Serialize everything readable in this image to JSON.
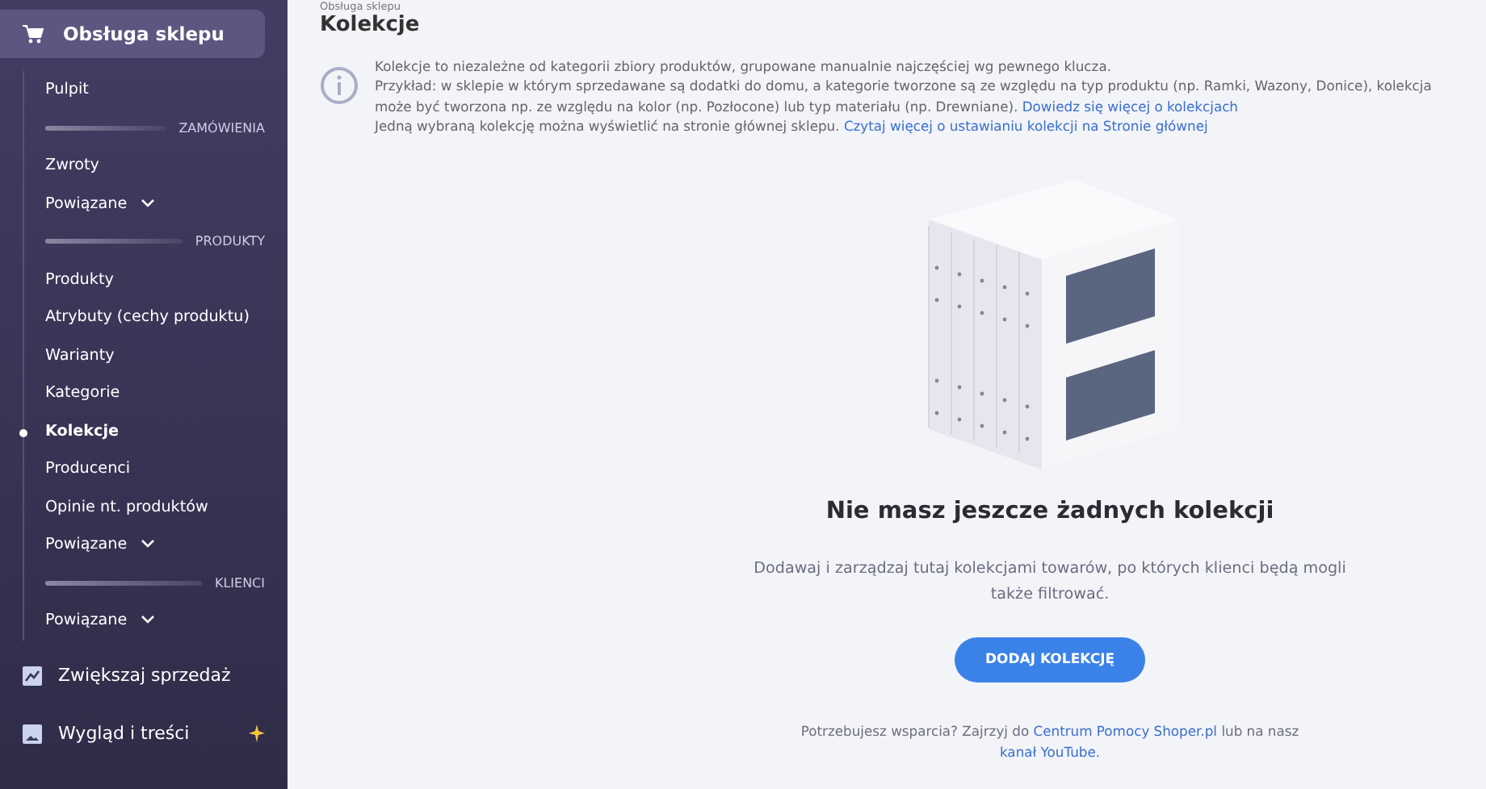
{
  "sidebar": {
    "header": {
      "label": "Obsługa sklepu",
      "expanded": true
    },
    "items": [
      {
        "kind": "link",
        "label": "Pulpit",
        "selected": false
      },
      {
        "kind": "section",
        "label": "ZAMÓWIENIA"
      },
      {
        "kind": "link",
        "label": "Zwroty",
        "selected": false
      },
      {
        "kind": "dropdown",
        "label": "Powiązane",
        "expanded": false
      },
      {
        "kind": "section",
        "label": "PRODUKTY"
      },
      {
        "kind": "link",
        "label": "Produkty",
        "selected": false
      },
      {
        "kind": "link",
        "label": "Atrybuty (cechy produktu)",
        "selected": false
      },
      {
        "kind": "link",
        "label": "Warianty",
        "selected": false
      },
      {
        "kind": "link",
        "label": "Kategorie",
        "selected": false
      },
      {
        "kind": "link",
        "label": "Kolekcje",
        "selected": true
      },
      {
        "kind": "link",
        "label": "Producenci",
        "selected": false
      },
      {
        "kind": "link",
        "label": "Opinie nt. produktów",
        "selected": false
      },
      {
        "kind": "dropdown",
        "label": "Powiązane",
        "expanded": false
      },
      {
        "kind": "section",
        "label": "KLIENCI"
      },
      {
        "kind": "dropdown",
        "label": "Powiązane",
        "expanded": false
      }
    ],
    "groups": [
      {
        "kind": "chart",
        "label": "Zwiększaj sprzedaż",
        "badge": false
      },
      {
        "kind": "image",
        "label": "Wygląd i treści",
        "badge": true
      }
    ]
  },
  "breadcrumb": "Obsługa sklepu",
  "title": "Kolekcje",
  "info": [
    {
      "text": "Kolekcje to niezależne od kategorii zbiory produktów, grupowane manualnie najczęściej wg pewnego klucza."
    },
    {
      "text": "Przykład: w sklepie w którym sprzedawane są dodatki do domu, a kategorie tworzone są ze względu na typ produktu (np. Ramki, Wazony, Donice), kolekcja może być tworzona np. ze względu na kolor (np. Pozłocone) lub typ materiału (np. Drewniane).",
      "link": "Dowiedz się więcej o kolekcjach"
    },
    {
      "text": "Jedną wybraną kolekcję można wyświetlić na stronie głównej sklepu.",
      "link": "Czytaj więcej o ustawianiu kolekcji na Stronie głównej"
    }
  ],
  "empty": {
    "heading": "Nie masz jeszcze żadnych kolekcji",
    "description": "Dodawaj i zarządzaj tutaj kolekcjami towarów, po których klienci będą mogli także filtrować.",
    "button": "DODAJ KOLEKCJĘ"
  },
  "help": {
    "text1": "Potrzebujesz wsparcia? Zajrzyj do",
    "link1": "Centrum Pomocy Shoper.pl",
    "text2": "lub na nasz",
    "link2": "kanał YouTube."
  }
}
